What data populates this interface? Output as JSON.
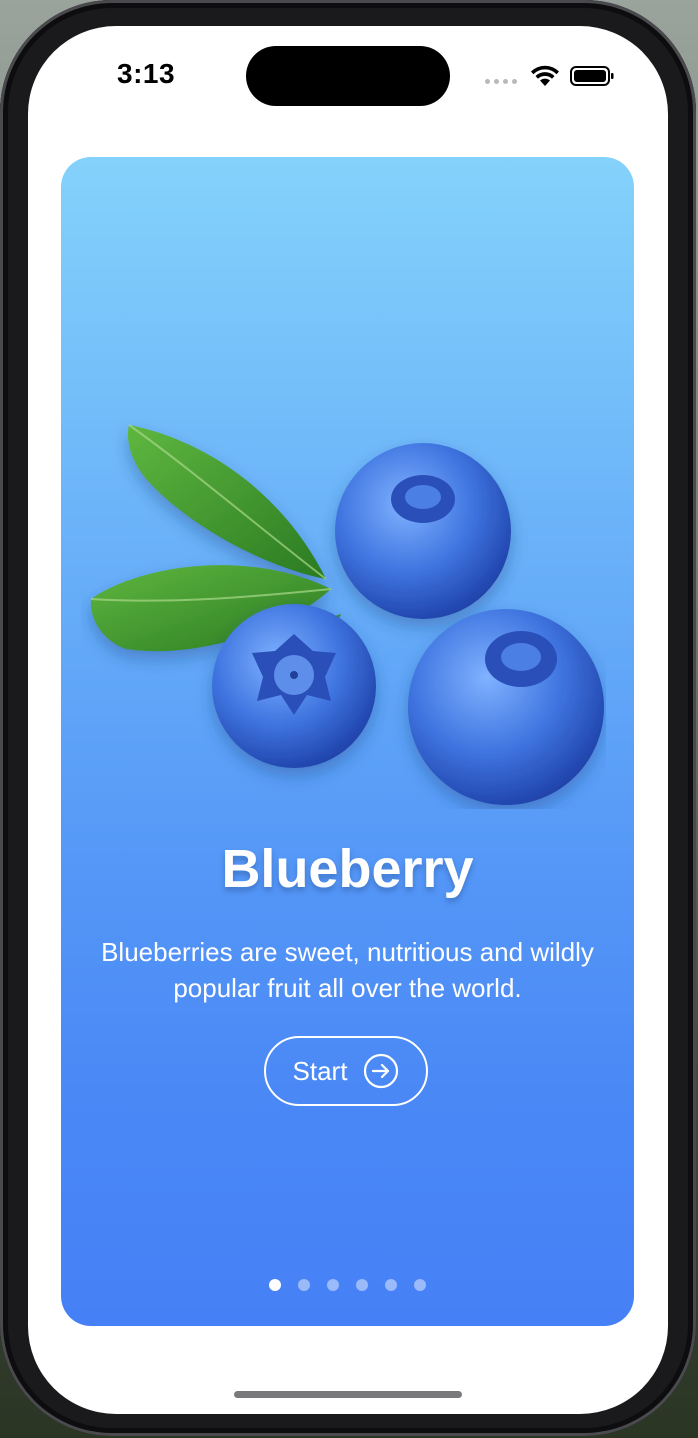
{
  "status_bar": {
    "time": "3:13",
    "signal_icon": "cellular-signal-icon",
    "wifi_icon": "wifi-icon",
    "battery_icon": "battery-icon"
  },
  "onboarding": {
    "fruit_image": "blueberries-with-leaves",
    "title": "Blueberry",
    "description": "Blueberries are sweet, nutritious and wildly popular fruit all over the world.",
    "start_button": {
      "label": "Start",
      "icon": "arrow-right-circle-icon"
    },
    "pagination": {
      "total_pages": 6,
      "current_page": 1
    }
  },
  "colors": {
    "card_gradient_top": "#84d2fb",
    "card_gradient_bottom": "#4680f6",
    "text": "#ffffff",
    "leaf": "#3f9a2e",
    "berry": "#3a6fd8"
  }
}
